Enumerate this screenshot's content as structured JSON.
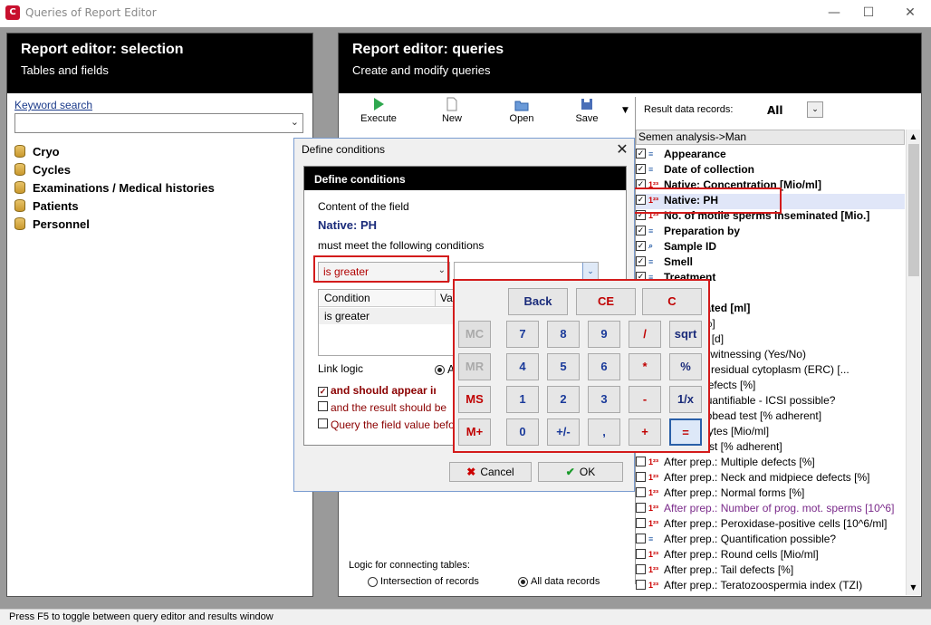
{
  "window": {
    "title": "Queries of Report Editor",
    "app_icon": "C",
    "min": "—",
    "max": "☐",
    "close": "✕"
  },
  "left_panel": {
    "title": "Report editor: selection",
    "subtitle": "Tables and fields",
    "keyword_label": "Keyword search",
    "keyword_value": "",
    "tree": [
      "Cryo",
      "Cycles",
      "Examinations / Medical histories",
      "Patients",
      "Personnel"
    ]
  },
  "right_panel": {
    "title": "Report editor: queries",
    "subtitle": "Create and modify queries",
    "toolbar": {
      "execute": "Execute",
      "new": "New",
      "open": "Open",
      "save": "Save"
    },
    "result_records_label": "Result data records:",
    "result_records_value": "All",
    "field_list_header": "Semen analysis->Man",
    "fields": [
      {
        "checked": true,
        "icon": "doc",
        "label": "Appearance",
        "bold": true
      },
      {
        "checked": true,
        "icon": "doc",
        "label": "Date of collection",
        "bold": true
      },
      {
        "checked": true,
        "icon": "num",
        "label": "Native: Concentration [Mio/ml]",
        "bold": true
      },
      {
        "checked": true,
        "icon": "num",
        "label": "Native: PH",
        "bold": true
      },
      {
        "checked": true,
        "icon": "num",
        "label": "No. of motile sperms inseminated [Mio.]",
        "bold": true
      },
      {
        "checked": true,
        "icon": "doc",
        "label": "Preparation by",
        "bold": true
      },
      {
        "checked": true,
        "icon": "search",
        "label": "Sample ID",
        "bold": true
      },
      {
        "checked": true,
        "icon": "doc",
        "label": "Smell",
        "bold": true
      },
      {
        "checked": true,
        "icon": "doc",
        "label": "Treatment",
        "bold": true
      },
      {
        "checked": false,
        "icon": "num",
        "label": "",
        "bold": false
      },
      {
        "checked": false,
        "icon": "num",
        "label": "inseminated [ml]",
        "bold": true
      },
      {
        "checked": false,
        "icon": "num",
        "label": "ity rate [%]",
        "bold": false
      },
      {
        "checked": false,
        "icon": "num",
        "label": "ce period [d]",
        "bold": false
      },
      {
        "checked": false,
        "icon": "num",
        "label": ".: Double witnessing (Yes/No)",
        "bold": false
      },
      {
        "checked": false,
        "icon": "num",
        "label": ".: Excess residual cytoplasm (ERC) [...",
        "bold": false
      },
      {
        "checked": false,
        "icon": "num",
        "label": ".: Head defects [%]",
        "bold": false
      },
      {
        "checked": false,
        "icon": "num",
        "label": ".: If not quantifiable - ICSI possible?",
        "bold": false
      },
      {
        "checked": false,
        "icon": "num",
        "label": ".: Immunobead test [% adherent]",
        "bold": false
      },
      {
        "checked": false,
        "icon": "num",
        "label": ".: Leucocytes [Mio/ml]",
        "bold": false
      },
      {
        "checked": false,
        "icon": "num",
        "label": ".: MAR test [% adherent]",
        "bold": false
      },
      {
        "checked": false,
        "icon": "num",
        "label": "After prep.: Multiple defects [%]",
        "bold": false
      },
      {
        "checked": false,
        "icon": "num",
        "label": "After prep.: Neck and midpiece defects [%]",
        "bold": false
      },
      {
        "checked": false,
        "icon": "num",
        "label": "After prep.: Normal forms [%]",
        "bold": false
      },
      {
        "checked": false,
        "icon": "num",
        "label": "After prep.: Number of prog. mot. sperms [10^6]",
        "bold": false,
        "purple": true
      },
      {
        "checked": false,
        "icon": "num",
        "label": "After prep.: Peroxidase-positive cells [10^6/ml]",
        "bold": false
      },
      {
        "checked": false,
        "icon": "doc",
        "label": "After prep.: Quantification possible?",
        "bold": false
      },
      {
        "checked": false,
        "icon": "num",
        "label": "After prep.: Round cells [Mio/ml]",
        "bold": false
      },
      {
        "checked": false,
        "icon": "num",
        "label": "After prep.: Tail defects [%]",
        "bold": false
      },
      {
        "checked": false,
        "icon": "num",
        "label": "After prep.: Teratozoospermia index (TZI)",
        "bold": false
      }
    ],
    "link_logic_label": "Logic for connecting tables:",
    "link_opt_1": "Intersection of records",
    "link_opt_2": "All data records"
  },
  "dialog": {
    "title": "Define conditions",
    "header": "Define conditions",
    "content_of": "Content of the field",
    "field_name": "Native: PH",
    "must_meet": "must meet the following conditions",
    "condition_selected": "is greater",
    "condition_value": "",
    "table_col_condition": "Condition",
    "table_col_value": "Va",
    "table_rows": [
      "is greater"
    ],
    "link_logic": "Link logic",
    "link_logic_opt": "A",
    "opt1": "and should appear in the",
    "opt2": "and the result should be",
    "opt3": "Query the field value befo",
    "cancel": "Cancel",
    "ok": "OK"
  },
  "calculator": {
    "keys": [
      "Back",
      "CE",
      "C",
      "MC",
      "7",
      "8",
      "9",
      "/",
      "sqrt",
      "MR",
      "4",
      "5",
      "6",
      "*",
      "%",
      "MS",
      "1",
      "2",
      "3",
      "-",
      "1/x",
      "M+",
      "0",
      "+/-",
      ",",
      "+",
      "="
    ]
  },
  "status_bar": "Press F5 to toggle between query editor and results window",
  "colors": {
    "highlight_red": "#d31b1b",
    "field_name_blue": "#1a2b7a",
    "option_red": "#8b0000"
  }
}
